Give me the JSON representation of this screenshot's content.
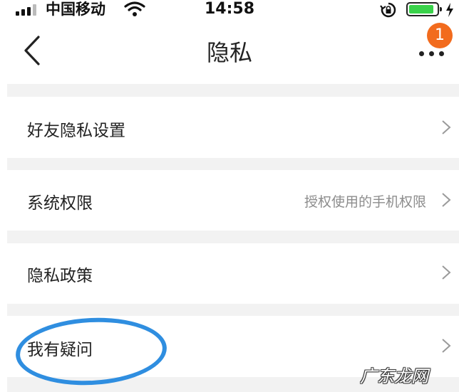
{
  "status_bar": {
    "carrier": "中国移动",
    "time": "14:58",
    "battery_level": 0.9,
    "icons": [
      "signal-icon",
      "wifi-icon",
      "rotation-lock-icon",
      "battery-icon",
      "charging-icon"
    ]
  },
  "nav": {
    "title": "隐私",
    "badge_count": "1",
    "back_icon": "chevron-left-icon",
    "more_icon": "more-dots-icon"
  },
  "items": [
    {
      "label": "好友隐私设置",
      "hint": ""
    },
    {
      "label": "系统权限",
      "hint": "授权使用的手机权限"
    },
    {
      "label": "隐私政策",
      "hint": ""
    },
    {
      "label": "我有疑问",
      "hint": ""
    }
  ],
  "watermark": "广东龙网",
  "colors": {
    "badge": "#f26b1d",
    "annotation_circle": "#2f8ee0",
    "battery_fill": "#39d24a",
    "separator": "#f2f2f2",
    "hint_text": "#8c8c8c"
  }
}
